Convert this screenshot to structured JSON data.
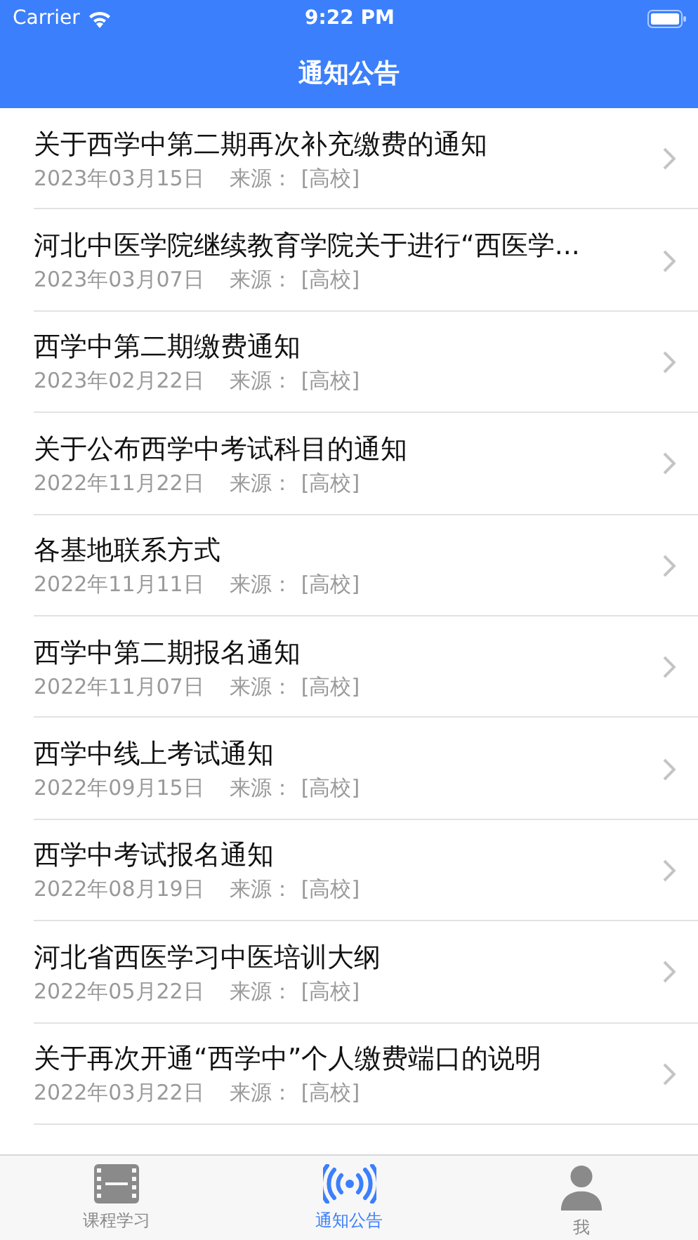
{
  "status_bar": {
    "carrier": "Carrier",
    "time": "9:22 PM"
  },
  "nav": {
    "title": "通知公告"
  },
  "notices": [
    {
      "title": "关于西学中第二期再次补充缴费的通知",
      "date": "2023年03月15日",
      "source_label": "来源：",
      "source": "[高校]"
    },
    {
      "title": "河北中医学院继续教育学院关于进行“西医学...",
      "date": "2023年03月07日",
      "source_label": "来源：",
      "source": "[高校]"
    },
    {
      "title": "西学中第二期缴费通知",
      "date": "2023年02月22日",
      "source_label": "来源：",
      "source": "[高校]"
    },
    {
      "title": "关于公布西学中考试科目的通知",
      "date": "2022年11月22日",
      "source_label": "来源：",
      "source": "[高校]"
    },
    {
      "title": "各基地联系方式",
      "date": "2022年11月11日",
      "source_label": "来源：",
      "source": "[高校]"
    },
    {
      "title": "西学中第二期报名通知",
      "date": "2022年11月07日",
      "source_label": "来源：",
      "source": "[高校]"
    },
    {
      "title": "西学中线上考试通知",
      "date": "2022年09月15日",
      "source_label": "来源：",
      "source": "[高校]"
    },
    {
      "title": "西学中考试报名通知",
      "date": "2022年08月19日",
      "source_label": "来源：",
      "source": "[高校]"
    },
    {
      "title": "河北省西医学习中医培训大纲",
      "date": "2022年05月22日",
      "source_label": "来源：",
      "source": "[高校]"
    },
    {
      "title": "关于再次开通“西学中”个人缴费端口的说明",
      "date": "2022年03月22日",
      "source_label": "来源：",
      "source": "[高校]"
    }
  ],
  "tab_bar": [
    {
      "label": "课程学习",
      "kind": "film",
      "selected": false
    },
    {
      "label": "通知公告",
      "kind": "broadcast",
      "selected": true
    },
    {
      "label": "我",
      "kind": "person",
      "selected": false
    }
  ]
}
